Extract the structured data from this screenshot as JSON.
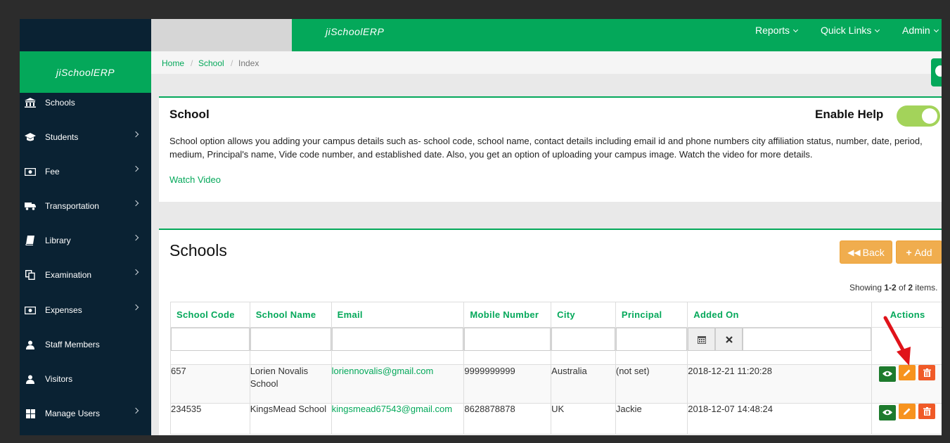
{
  "sidebar": {
    "logo": "jiSchoolERP",
    "items": [
      {
        "label": "Schools",
        "icon": "bank-icon",
        "has_sub": false
      },
      {
        "label": "Students",
        "icon": "graduation-cap-icon",
        "has_sub": true
      },
      {
        "label": "Fee",
        "icon": "money-icon",
        "has_sub": true
      },
      {
        "label": "Transportation",
        "icon": "truck-icon",
        "has_sub": true
      },
      {
        "label": "Library",
        "icon": "book-icon",
        "has_sub": true
      },
      {
        "label": "Examination",
        "icon": "copy-icon",
        "has_sub": true
      },
      {
        "label": "Expenses",
        "icon": "money-icon",
        "has_sub": true
      },
      {
        "label": "Staff Members",
        "icon": "user-icon",
        "has_sub": false
      },
      {
        "label": "Visitors",
        "icon": "user-icon",
        "has_sub": false
      },
      {
        "label": "Manage Users",
        "icon": "grid-icon",
        "has_sub": true
      }
    ]
  },
  "topbar": {
    "brand": "jiSchoolERP",
    "nav": [
      "Reports",
      "Quick Links",
      "Admin"
    ]
  },
  "breadcrumb": {
    "home": "Home",
    "school": "School",
    "current": "Index",
    "sep": "/"
  },
  "help": {
    "title": "School",
    "enable_label": "Enable Help",
    "toggle_on": true,
    "description": "School option allows you adding your campus details such as- school code, school name, contact details including email id and phone numbers city affiliation status, number, date, period, medium, Principal's name, Vide code number, and established date. Also, you get an option of uploading your campus image. Watch the video for more details.",
    "link": "Watch Video"
  },
  "schools": {
    "title": "Schools",
    "back_label": "Back",
    "add_label": "Add",
    "summary_prefix": "Showing ",
    "summary_range": "1-2",
    "summary_mid": " of ",
    "summary_total": "2",
    "summary_suffix": " items.",
    "columns": [
      "School Code",
      "School Name",
      "Email",
      "Mobile Number",
      "City",
      "Principal",
      "Added On",
      "Actions"
    ],
    "rows": [
      {
        "code": "657",
        "name": "Lorien Novalis School",
        "email": "loriennovalis@gmail.com",
        "mobile": "9999999999",
        "city": "Australia",
        "principal": "(not set)",
        "added": "2018-12-21 11:20:28"
      },
      {
        "code": "234535",
        "name": "KingsMead School",
        "email": "kingsmead67543@gmail.com",
        "mobile": "8628878878",
        "city": "UK",
        "principal": "Jackie",
        "added": "2018-12-07 14:48:24"
      }
    ]
  },
  "colors": {
    "brand_green": "#04a85a",
    "sidebar_bg": "#0a2233",
    "button_orange": "#f0ad4e",
    "annotation_arrow": "#e0131a"
  }
}
